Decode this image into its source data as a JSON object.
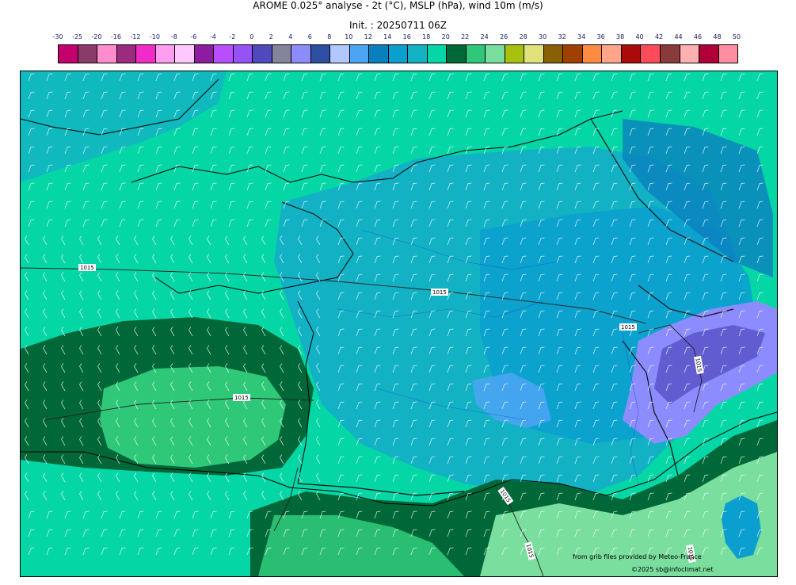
{
  "title": "AROME 0.025° analyse - 2t (°C), MSLP (hPa), wind 10m (m/s)",
  "subtitle": "Init. : 20250711 06Z",
  "colorbar": {
    "labels": [
      "-30",
      "-25",
      "-20",
      "-16",
      "-12",
      "-10",
      "-8",
      "-6",
      "-4",
      "-2",
      "0",
      "2",
      "4",
      "6",
      "8",
      "10",
      "12",
      "14",
      "16",
      "18",
      "20",
      "22",
      "24",
      "26",
      "28",
      "30",
      "32",
      "34",
      "36",
      "38",
      "40",
      "42",
      "44",
      "46",
      "48",
      "50"
    ],
    "colors": [
      "#c4006e",
      "#8b3b6a",
      "#ff8ccc",
      "#9c2a7e",
      "#f22ac8",
      "#ff9ef0",
      "#ffc8ff",
      "#8e1ca0",
      "#b84eff",
      "#9552f5",
      "#4f49bd",
      "#84849c",
      "#8c8cff",
      "#2e4ea2",
      "#b0c8ff",
      "#4da4f5",
      "#0a7fbf",
      "#0a9fcf",
      "#12b2c4",
      "#05d6a6",
      "#006838",
      "#2ec878",
      "#7ade9e",
      "#a8c010",
      "#e2e27a",
      "#8a6006",
      "#a04000",
      "#ff8a42",
      "#ffa68a",
      "#aa0a0a",
      "#ff4a5a",
      "#8a3a3a",
      "#ffb0b0",
      "#b0003a",
      "#ff8ea0"
    ]
  },
  "isobars": [
    "1015",
    "1015",
    "1015",
    "1015",
    "1015",
    "1015",
    "1015",
    "1015"
  ],
  "credits": {
    "source": "from grib files provided by Meteo-France",
    "copyright": "©2025 sb@infoclimat.net"
  },
  "colors": {
    "sea_base": "#05d6a6",
    "warm": "#2ec878",
    "dark_warm": "#006838",
    "light_warm": "#7ade9e",
    "cool": "#12b2c4",
    "cooler": "#0a9fcf",
    "coolest": "#0a7fbf",
    "cold": "#4da4f5",
    "alps": "#8c8cff"
  }
}
